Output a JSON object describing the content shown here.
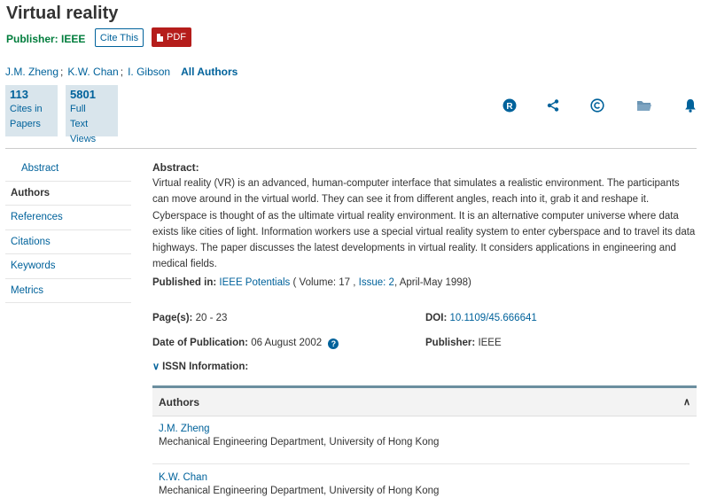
{
  "article": {
    "title": "Virtual reality",
    "publisher_label": "Publisher: IEEE"
  },
  "buttons": {
    "cite": "Cite This",
    "pdf": "PDF"
  },
  "authors_line": {
    "names": [
      "J.M. Zheng",
      "K.W. Chan",
      "I. Gibson"
    ],
    "separator": ";",
    "all_authors": "All Authors"
  },
  "metrics": [
    {
      "value": "113",
      "label_line1": "Cites in",
      "label_line2": "Papers"
    },
    {
      "value": "5801",
      "label_line1": "Full",
      "label_line2": "Text Views"
    }
  ],
  "toolbar_icons": [
    "rights-icon",
    "share-icon",
    "copyright-icon",
    "folder-icon",
    "bell-icon"
  ],
  "sidenav": {
    "items": [
      "Abstract",
      "Authors",
      "References",
      "Citations",
      "Keywords",
      "Metrics"
    ],
    "active": "Authors"
  },
  "abstract": {
    "label": "Abstract:",
    "text": "Virtual reality (VR) is an advanced, human-computer interface that simulates a realistic environment. The participants can move around in the virtual world. They can see it from different angles, reach into it, grab it and reshape it. Cyberspace is thought of as the ultimate virtual reality environment. It is an alternative computer universe where data exists like cities of light. Information workers use a special virtual reality system to enter cyberspace and to travel its data highways. The paper discusses the latest developments in virtual reality. It considers applications in engineering and medical fields."
  },
  "published_in": {
    "label": "Published in:",
    "journal": "IEEE Potentials",
    "volume_text": "( Volume: 17 , ",
    "issue": "Issue: 2",
    "date_text": ", April-May 1998)"
  },
  "details": {
    "pages_label": "Page(s):",
    "pages_value": "20 - 23",
    "doi_label": "DOI:",
    "doi_value": "10.1109/45.666641",
    "pubdate_label": "Date of Publication:",
    "pubdate_value": "06 August 2002",
    "publisher_label": "Publisher:",
    "publisher_value": "IEEE"
  },
  "issn": {
    "label": "ISSN Information:"
  },
  "authors_panel": {
    "title": "Authors",
    "authors": [
      {
        "name": "J.M. Zheng",
        "affiliation": "Mechanical Engineering Department, University of Hong Kong"
      },
      {
        "name": "K.W. Chan",
        "affiliation": "Mechanical Engineering Department, University of Hong Kong"
      }
    ]
  },
  "colors": {
    "link": "#00629b",
    "publisher_green": "#007d3c",
    "pdf_red": "#b51d1b",
    "metric_bg": "#d9e5ec",
    "panel_border": "#6b8e9f"
  }
}
